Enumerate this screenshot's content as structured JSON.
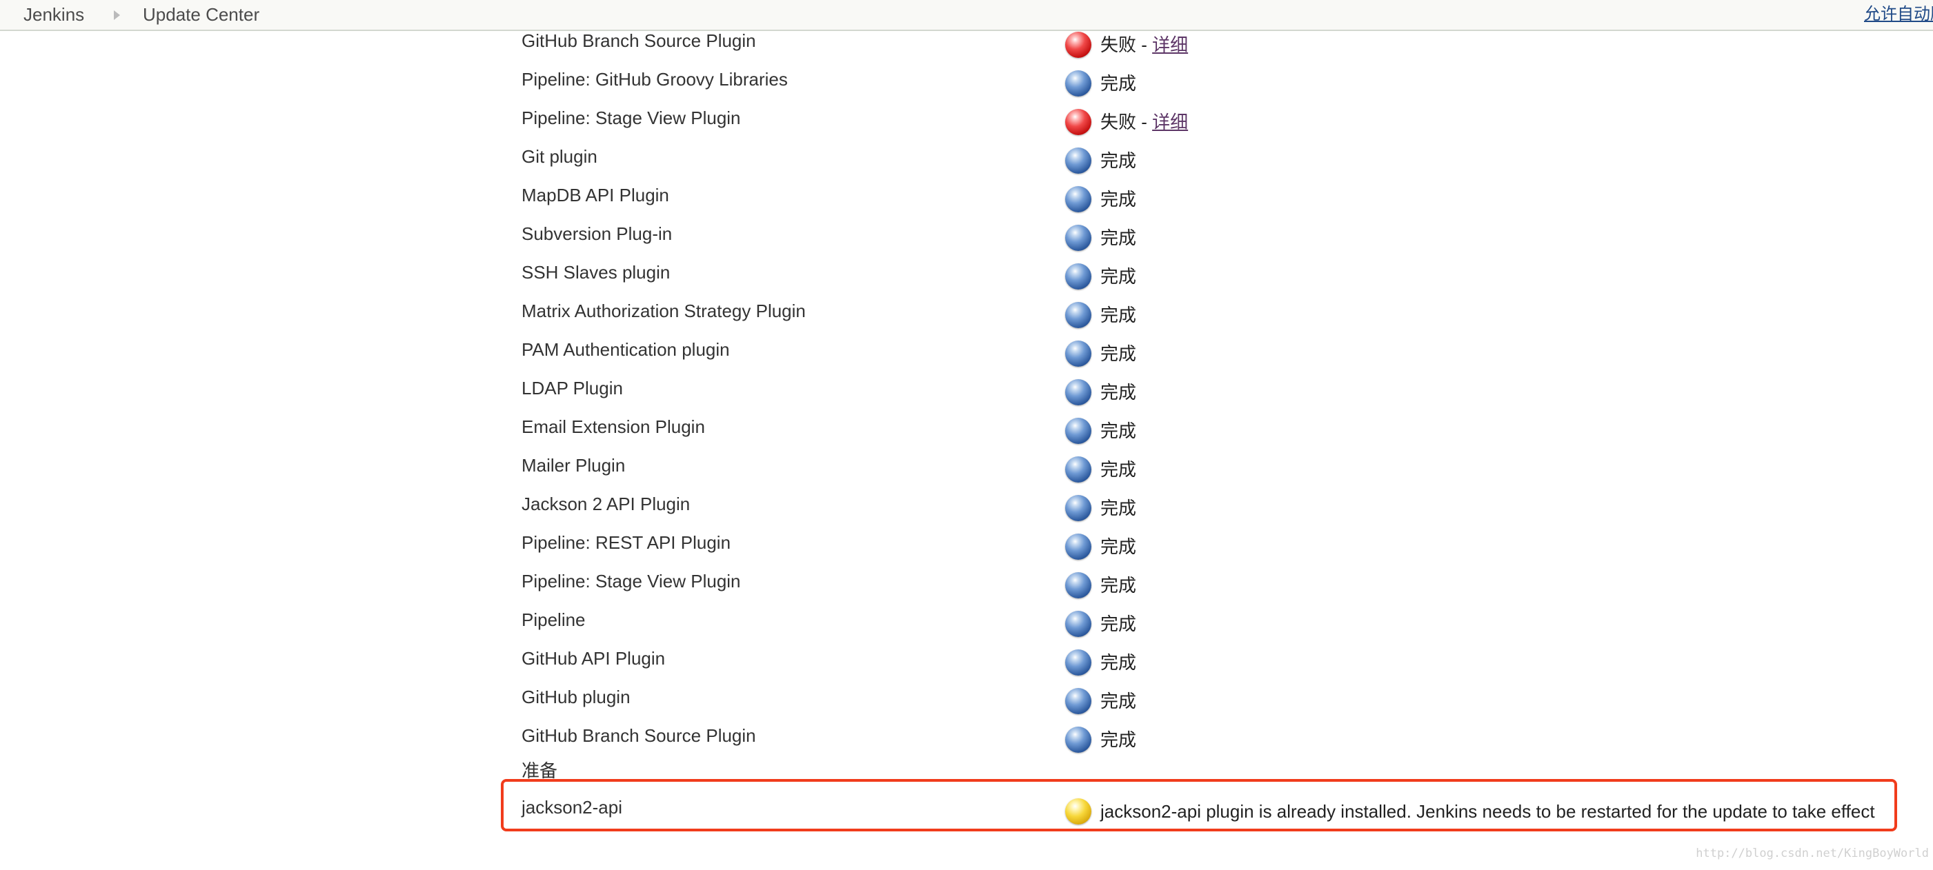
{
  "breadcrumb": {
    "home": "Jenkins",
    "current": "Update Center",
    "separator_icon": "breadcrumb-arrow-icon"
  },
  "header": {
    "auto_refresh_link": "允许自动刷"
  },
  "plugins": [
    {
      "name": "GitHub Branch Source Plugin",
      "status_color": "red",
      "status": "失败",
      "separator": " - ",
      "link": "详细"
    },
    {
      "name": "Pipeline: GitHub Groovy Libraries",
      "status_color": "blue",
      "status": "完成"
    },
    {
      "name": "Pipeline: Stage View Plugin",
      "status_color": "red",
      "status": "失败",
      "separator": " - ",
      "link": "详细"
    },
    {
      "name": "Git plugin",
      "status_color": "blue",
      "status": "完成"
    },
    {
      "name": "MapDB API Plugin",
      "status_color": "blue",
      "status": "完成"
    },
    {
      "name": "Subversion Plug-in",
      "status_color": "blue",
      "status": "完成"
    },
    {
      "name": "SSH Slaves plugin",
      "status_color": "blue",
      "status": "完成"
    },
    {
      "name": "Matrix Authorization Strategy Plugin",
      "status_color": "blue",
      "status": "完成"
    },
    {
      "name": "PAM Authentication plugin",
      "status_color": "blue",
      "status": "完成"
    },
    {
      "name": "LDAP Plugin",
      "status_color": "blue",
      "status": "完成"
    },
    {
      "name": "Email Extension Plugin",
      "status_color": "blue",
      "status": "完成"
    },
    {
      "name": "Mailer Plugin",
      "status_color": "blue",
      "status": "完成"
    },
    {
      "name": "Jackson 2 API Plugin",
      "status_color": "blue",
      "status": "完成"
    },
    {
      "name": "Pipeline: REST API Plugin",
      "status_color": "blue",
      "status": "完成"
    },
    {
      "name": "Pipeline: Stage View Plugin",
      "status_color": "blue",
      "status": "完成"
    },
    {
      "name": "Pipeline",
      "status_color": "blue",
      "status": "完成"
    },
    {
      "name": "GitHub API Plugin",
      "status_color": "blue",
      "status": "完成"
    },
    {
      "name": "GitHub plugin",
      "status_color": "blue",
      "status": "完成"
    },
    {
      "name": "GitHub Branch Source Plugin",
      "status_color": "blue",
      "status": "完成"
    }
  ],
  "pending": {
    "section_label": "准备",
    "name": "jackson2-api",
    "status_color": "yellow",
    "status": "jackson2-api plugin is already installed. Jenkins needs to be restarted for the update to take effect"
  },
  "colors": {
    "highlight_border": "#f13c1c",
    "link": "#5c3566",
    "success_ball": "blue",
    "failure_ball": "red",
    "pending_ball": "yellow"
  },
  "watermark": "http://blog.csdn.net/KingBoyWorld"
}
